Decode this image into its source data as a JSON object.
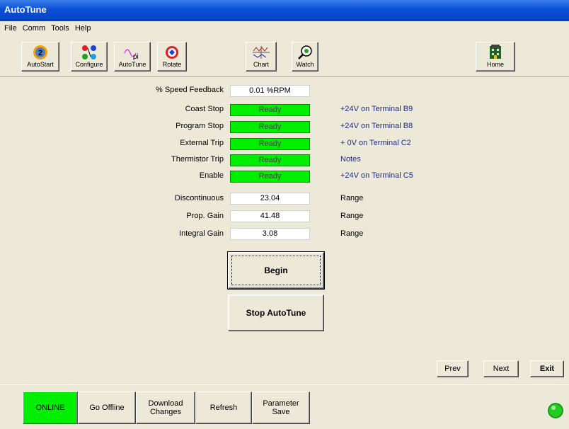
{
  "window": {
    "title": "AutoTune"
  },
  "menu": [
    "File",
    "Comm",
    "Tools",
    "Help"
  ],
  "toolbar": {
    "autostart": "AutoStart",
    "configure": "Configure",
    "autotune": "AutoTune",
    "rotate": "Rotate",
    "chart": "Chart",
    "watch": "Watch",
    "home": "Home"
  },
  "speed_feedback": {
    "label": "% Speed Feedback",
    "value": "0.01 %RPM"
  },
  "status_rows": [
    {
      "label": "Coast Stop",
      "status": "Ready",
      "note": "+24V on Terminal B9"
    },
    {
      "label": "Program Stop",
      "status": "Ready",
      "note": "+24V on Terminal B8"
    },
    {
      "label": "External Trip",
      "status": "Ready",
      "note": "+ 0V on Terminal C2"
    },
    {
      "label": "Thermistor Trip",
      "status": "Ready",
      "note": "Notes"
    },
    {
      "label": "Enable",
      "status": "Ready",
      "note": "+24V on Terminal C5"
    }
  ],
  "params": [
    {
      "label": "Discontinuous",
      "value": "23.04",
      "range": "Range"
    },
    {
      "label": "Prop. Gain",
      "value": "41.48",
      "range": "Range"
    },
    {
      "label": "Integral Gain",
      "value": "3.08",
      "range": "Range"
    }
  ],
  "actions": {
    "begin": "Begin",
    "stop": "Stop AutoTune"
  },
  "nav": {
    "prev": "Prev",
    "next": "Next",
    "exit": "Exit"
  },
  "statusbar": {
    "online": "ONLINE",
    "go_offline": "Go Offline",
    "download_line1": "Download",
    "download_line2": "Changes",
    "refresh": "Refresh",
    "param_save_line1": "Parameter",
    "param_save_line2": "Save"
  },
  "colors": {
    "ready": "#00EE00",
    "online": "#00EE00",
    "note": "#1E2A8C",
    "titlebar": "#0A4FD6"
  }
}
